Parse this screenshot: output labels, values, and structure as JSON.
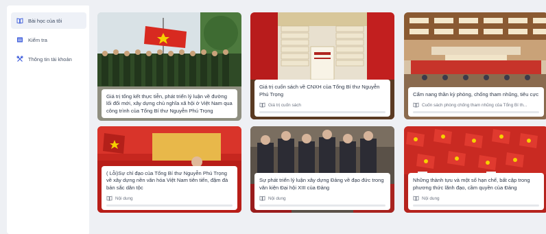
{
  "sidebar": {
    "items": [
      {
        "label": "Bài học của tôi",
        "icon": "book-open-icon",
        "active": true
      },
      {
        "label": "Kiểm tra",
        "icon": "table-icon",
        "active": false
      },
      {
        "label": "Thông tin tài khoản",
        "icon": "tools-icon",
        "active": false
      }
    ]
  },
  "cards": [
    {
      "title": "Giá trị tổng kết thực tiễn, phát triển lý luận về đường lối đổi mới, xây dựng chủ nghĩa xã hội ở Việt Nam qua công trình của Tổng Bí thư Nguyễn Phú Trọng",
      "meta": "",
      "image": "soldiers-parade-flag"
    },
    {
      "title": "Giá trị cuốn sách về CNXH của Tổng Bí thư Nguyễn Phú Trọng",
      "meta": "Giá trị cuốn sách",
      "image": "book-stacks"
    },
    {
      "title": "Cẩm nang thần kỳ phòng, chống tham nhũng, tiêu cực",
      "meta": "Cuốn sách phòng chống tham nhũng của Tổng Bí th...",
      "image": "conference-hall"
    },
    {
      "title": "( Lỗi)Sự chỉ đạo của Tổng Bí thư Nguyễn Phú Trọng về xây dựng nền văn hóa Việt Nam tiên tiến, đậm đà bản sắc dân tộc",
      "meta": "Nội dung",
      "image": "speaker-podium"
    },
    {
      "title": "Sự phát triển lý luận xây dựng Đảng về đạo đức trong văn kiện Đại hội XIII của Đảng",
      "meta": "Nội dung",
      "image": "crowd-signing"
    },
    {
      "title": "Những thành tựu và một số hạn chế, bất cập trong phương thức lãnh đạo, cầm quyền của Đảng",
      "meta": "Nội dung",
      "image": "crowd-flags"
    }
  ]
}
